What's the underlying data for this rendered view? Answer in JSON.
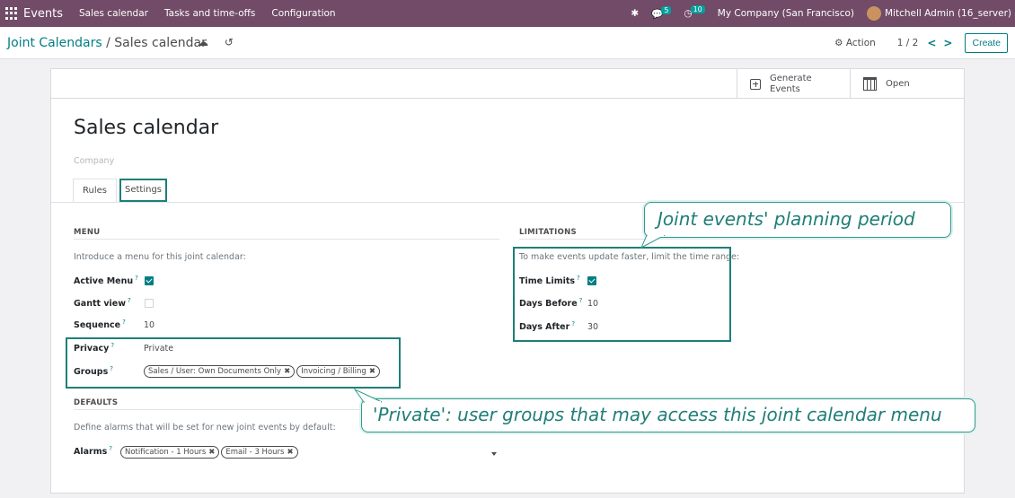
{
  "navbar": {
    "app_name": "Events",
    "menus": [
      "Sales calendar",
      "Tasks and time-offs",
      "Configuration"
    ],
    "messages_count": "5",
    "activities_count": "10",
    "company": "My Company (San Francisco)",
    "user": "Mitchell Admin (16_server)"
  },
  "control_panel": {
    "breadcrumb_parent": "Joint Calendars",
    "breadcrumb_separator": "/",
    "breadcrumb_current": "Sales calendar",
    "action_label": "Action",
    "pager": "1 / 2",
    "create_label": "Create"
  },
  "button_box": {
    "generate_line1": "Generate",
    "generate_line2": "Events",
    "open_label": "Open"
  },
  "form": {
    "title": "Sales calendar",
    "company_placeholder": "Company",
    "tabs": [
      "Rules",
      "Settings"
    ],
    "menu_section": {
      "title": "MENU",
      "description": "Introduce a menu for this joint calendar:",
      "active_menu_label": "Active Menu",
      "gantt_view_label": "Gantt view",
      "sequence_label": "Sequence",
      "sequence_value": "10",
      "privacy_label": "Privacy",
      "privacy_value": "Private",
      "groups_label": "Groups",
      "groups": [
        "Sales / User: Own Documents Only",
        "Invoicing / Billing"
      ]
    },
    "limitations_section": {
      "title": "LIMITATIONS",
      "description": "To make events update faster, limit the time range:",
      "time_limits_label": "Time Limits",
      "days_before_label": "Days Before",
      "days_before_value": "10",
      "days_after_label": "Days After",
      "days_after_value": "30"
    },
    "defaults_section": {
      "title": "DEFAULTS",
      "description": "Define alarms that will be set for new joint events by default:",
      "alarms_label": "Alarms",
      "alarms": [
        "Notification - 1 Hours",
        "Email - 3 Hours"
      ]
    }
  },
  "annotations": {
    "planning_period": "Joint events' planning period",
    "private_groups": "'Private': user groups that may access this joint calendar menu"
  },
  "help_marker": "?",
  "remove_marker": "✖",
  "colors": {
    "navbar": "#714b67",
    "accent": "#017e84",
    "highlight": "#1f7e78"
  }
}
